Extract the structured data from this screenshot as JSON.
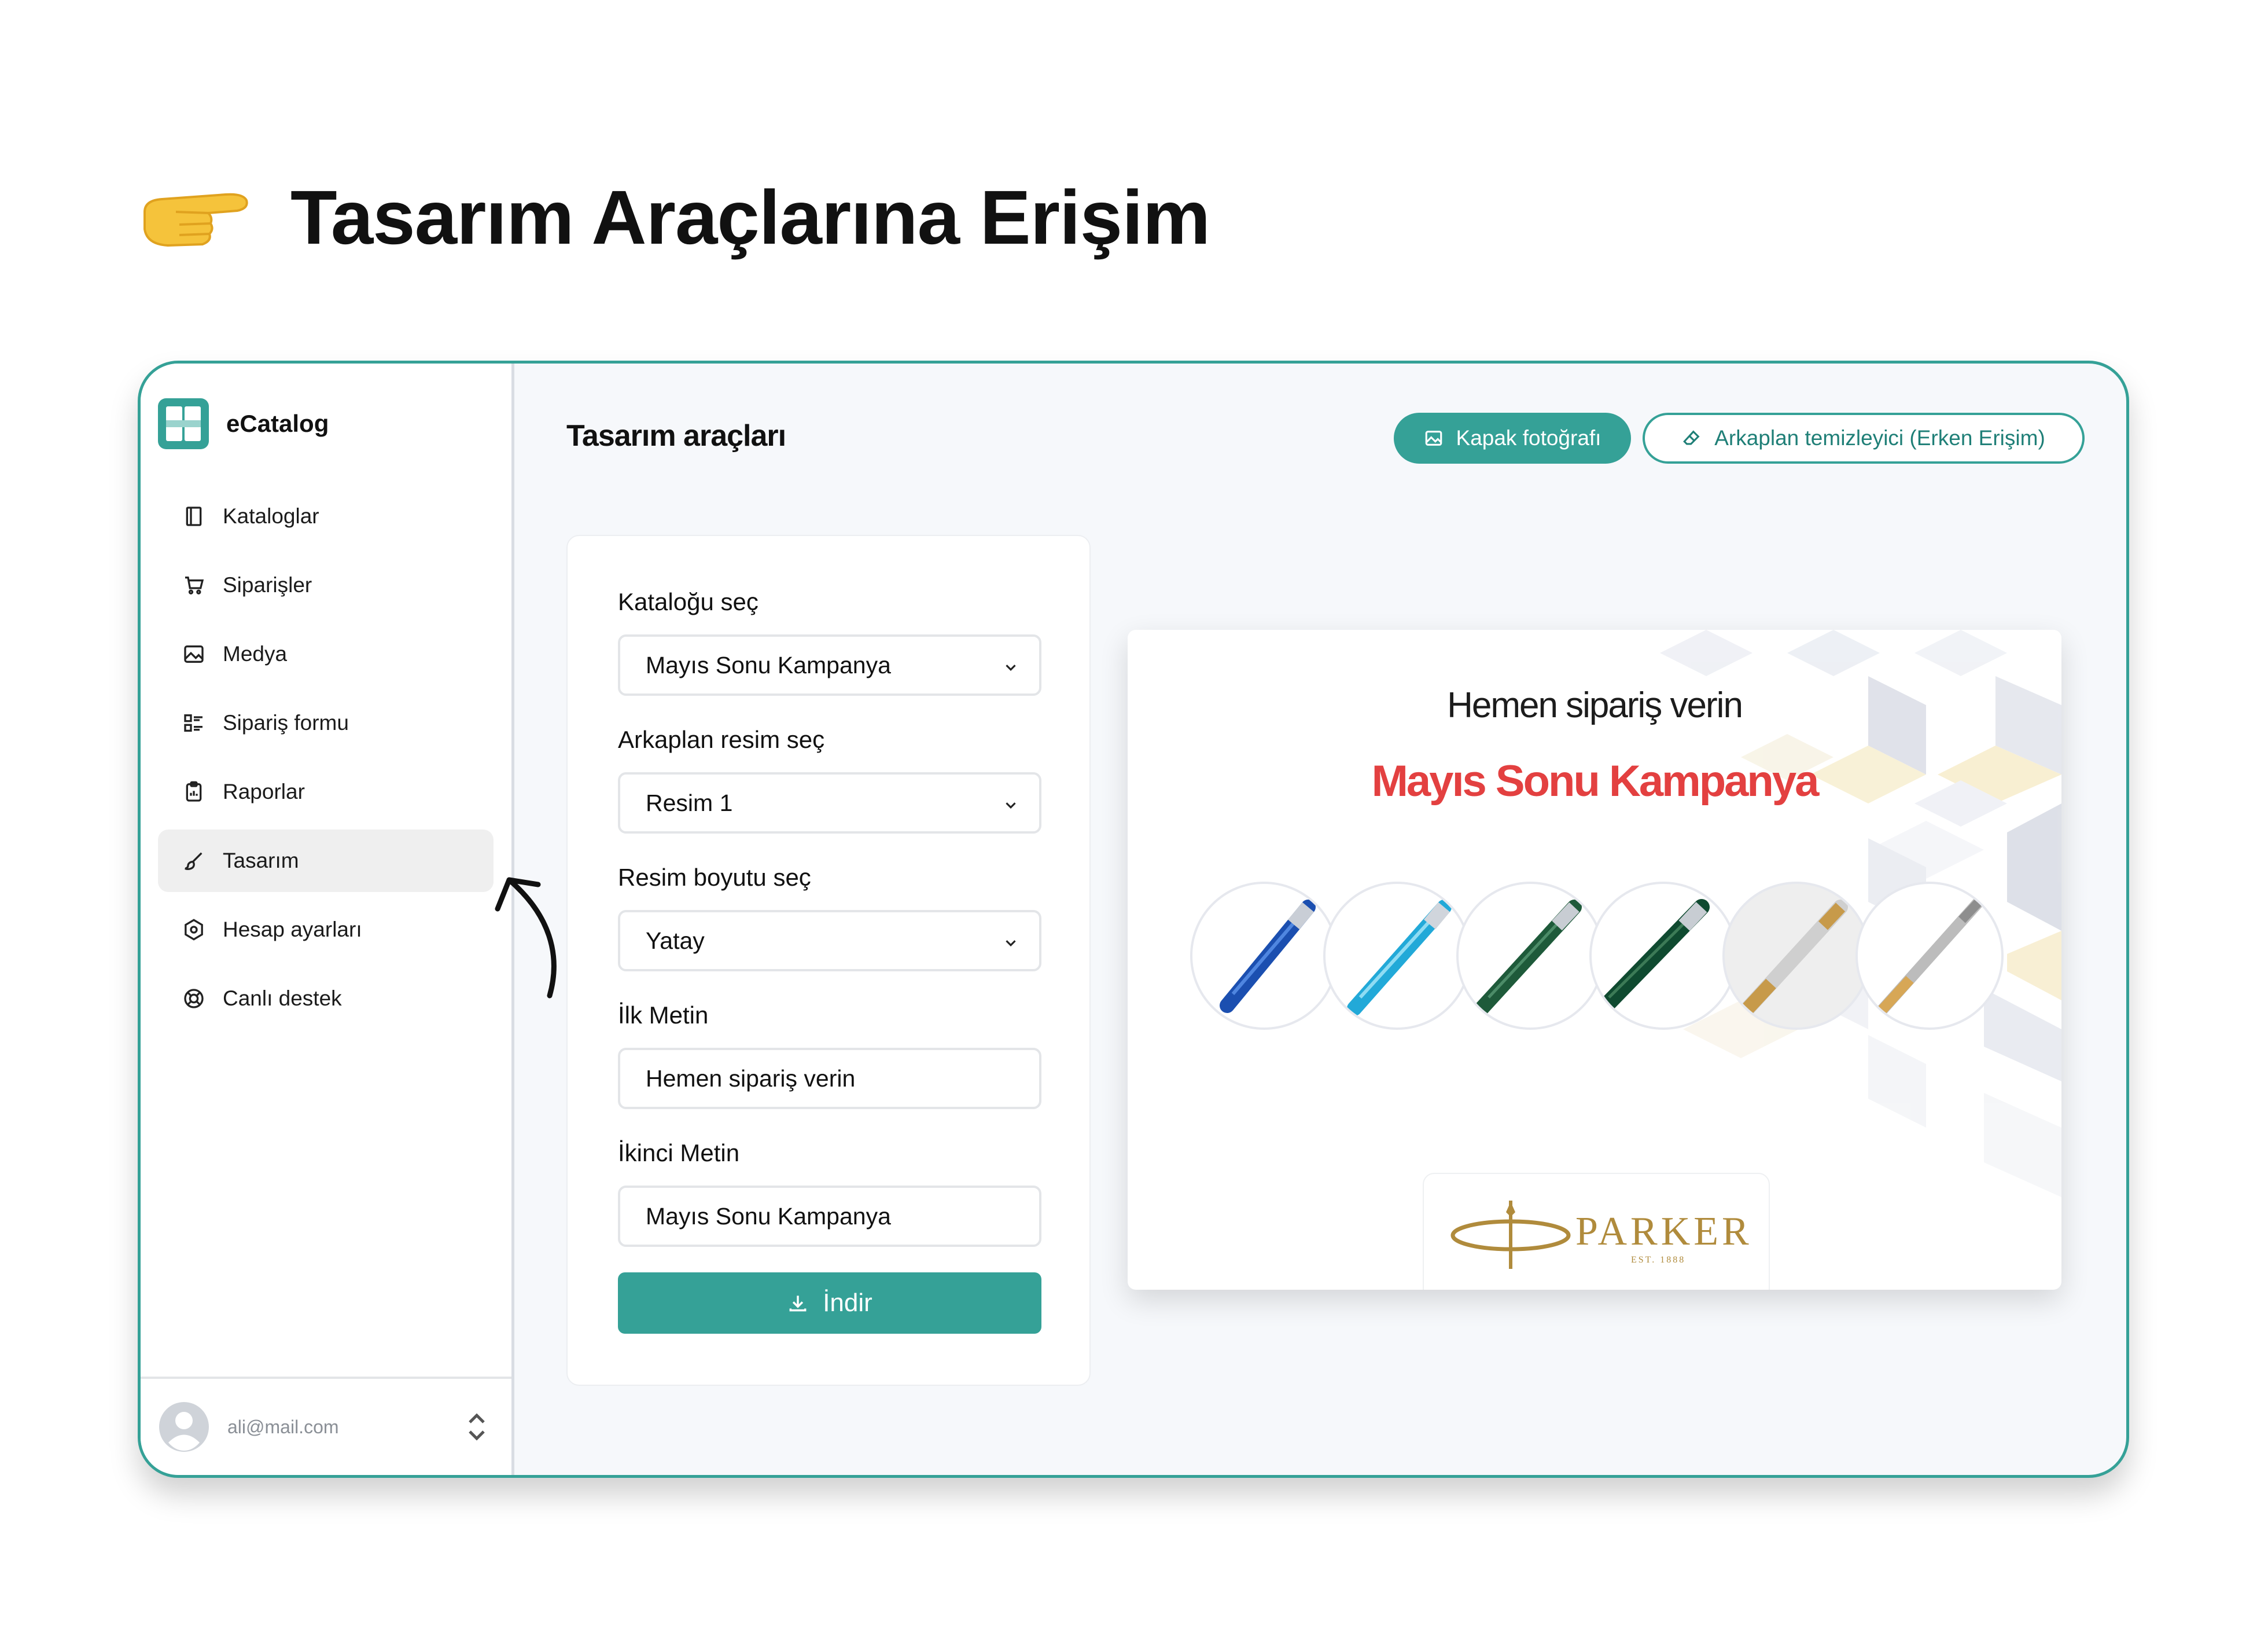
{
  "hero": {
    "emoji": "👉",
    "title": "Tasarım Araçlarına Erişim"
  },
  "app": {
    "name": "eCatalog",
    "nav": [
      {
        "label": "Kataloglar",
        "icon": "book-icon"
      },
      {
        "label": "Siparişler",
        "icon": "cart-icon"
      },
      {
        "label": "Medya",
        "icon": "image-icon"
      },
      {
        "label": "Sipariş formu",
        "icon": "form-list-icon"
      },
      {
        "label": "Raporlar",
        "icon": "clipboard-icon"
      },
      {
        "label": "Tasarım",
        "icon": "brush-icon",
        "active": true
      },
      {
        "label": "Hesap ayarları",
        "icon": "settings-hex-icon"
      },
      {
        "label": "Canlı destek",
        "icon": "lifebuoy-icon"
      }
    ],
    "user_email": "ali@mail.com"
  },
  "main": {
    "title": "Tasarım araçları",
    "cover_button": "Kapak fotoğrafı",
    "bg_remover_button": "Arkaplan temizleyici (Erken Erişim)",
    "form": {
      "catalog_label": "Kataloğu seç",
      "catalog_value": "Mayıs Sonu Kampanya",
      "bg_label": "Arkaplan resim seç",
      "bg_value": "Resim 1",
      "size_label": "Resim boyutu seç",
      "size_value": "Yatay",
      "first_text_label": "İlk Metin",
      "first_text_value": "Hemen sipariş verin",
      "second_text_label": "İkinci Metin",
      "second_text_value": "Mayıs Sonu Kampanya",
      "download_button": "İndir"
    },
    "preview": {
      "first_text": "Hemen sipariş verin",
      "second_text": "Mayıs Sonu Kampanya",
      "brand_name": "PARKER",
      "brand_est": "EST. 1888"
    }
  },
  "colors": {
    "accent": "#35a197",
    "campaign_red": "#e34040",
    "brand_gold": "#b08b3c"
  }
}
